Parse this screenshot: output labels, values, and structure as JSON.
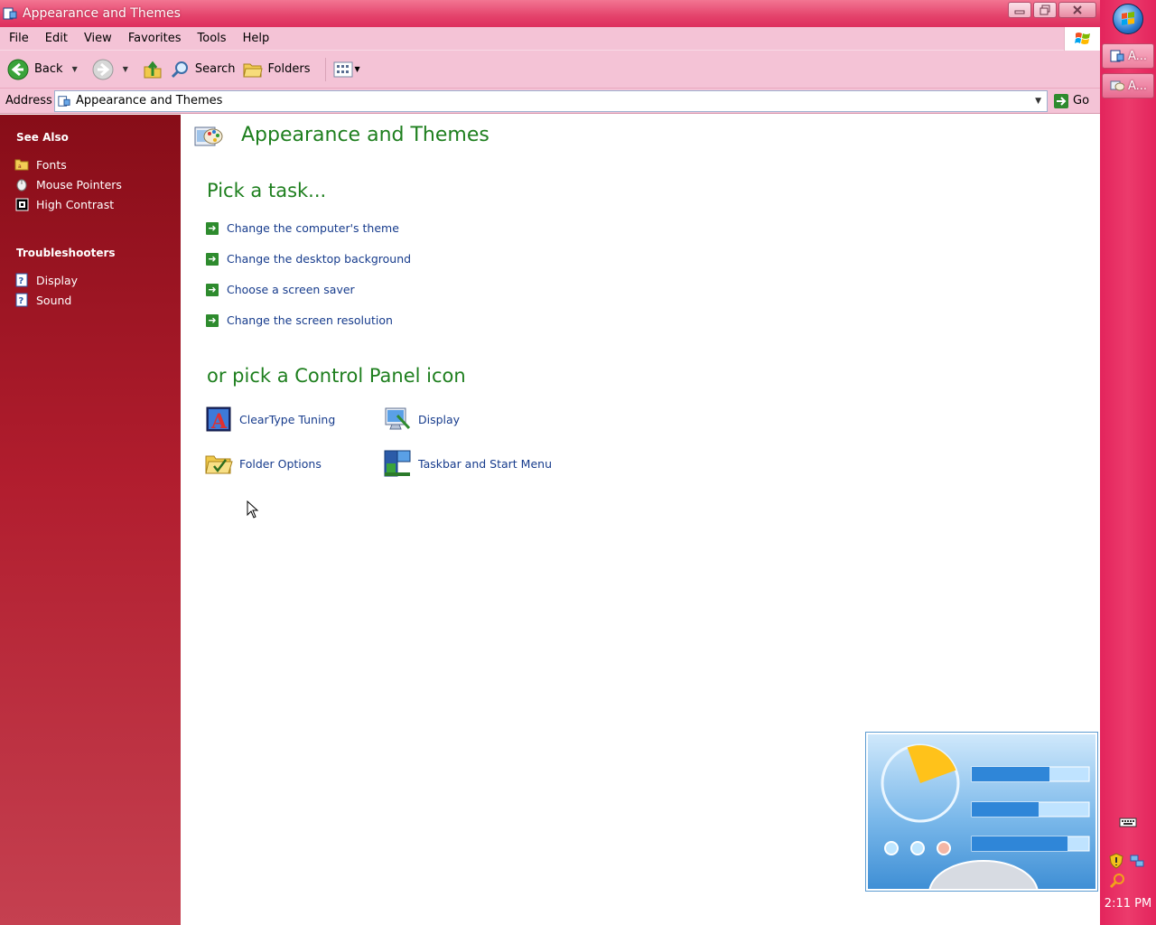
{
  "window": {
    "title": "Appearance and Themes",
    "controls": {
      "minimize": "minimize",
      "maximize": "restore",
      "close": "close"
    }
  },
  "menu": {
    "items": [
      "File",
      "Edit",
      "View",
      "Favorites",
      "Tools",
      "Help"
    ]
  },
  "toolbar": {
    "back_label": "Back",
    "search_label": "Search",
    "folders_label": "Folders"
  },
  "address": {
    "label": "Address",
    "value": "Appearance and Themes",
    "go_label": "Go"
  },
  "sidebar": {
    "see_also_heading": "See Also",
    "see_also": [
      {
        "label": "Fonts",
        "icon": "folder-icon"
      },
      {
        "label": "Mouse Pointers",
        "icon": "mouse-icon"
      },
      {
        "label": "High Contrast",
        "icon": "contrast-icon"
      }
    ],
    "troubleshooters_heading": "Troubleshooters",
    "troubleshooters": [
      {
        "label": "Display",
        "icon": "help-icon"
      },
      {
        "label": "Sound",
        "icon": "help-icon"
      }
    ]
  },
  "main": {
    "title": "Appearance and Themes",
    "tasks_heading": "Pick a task...",
    "tasks": [
      "Change the computer's theme",
      "Change the desktop background",
      "Choose a screen saver",
      "Change the screen resolution"
    ],
    "icons_heading": "or pick a Control Panel icon",
    "icons": [
      {
        "label": "ClearType Tuning",
        "icon": "cleartype-icon"
      },
      {
        "label": "Display",
        "icon": "display-icon"
      },
      {
        "label": "Folder Options",
        "icon": "folder-options-icon"
      },
      {
        "label": "Taskbar and Start Menu",
        "icon": "taskbar-icon"
      }
    ]
  },
  "taskbar": {
    "tasks": [
      {
        "label": "A..."
      },
      {
        "label": "A..."
      }
    ],
    "clock": "2:11 PM"
  },
  "colors": {
    "accent_green": "#1e7f1e",
    "link_blue": "#163b8c",
    "sidebar_red": "#a0141f",
    "taskbar_pink": "#e3245c"
  }
}
